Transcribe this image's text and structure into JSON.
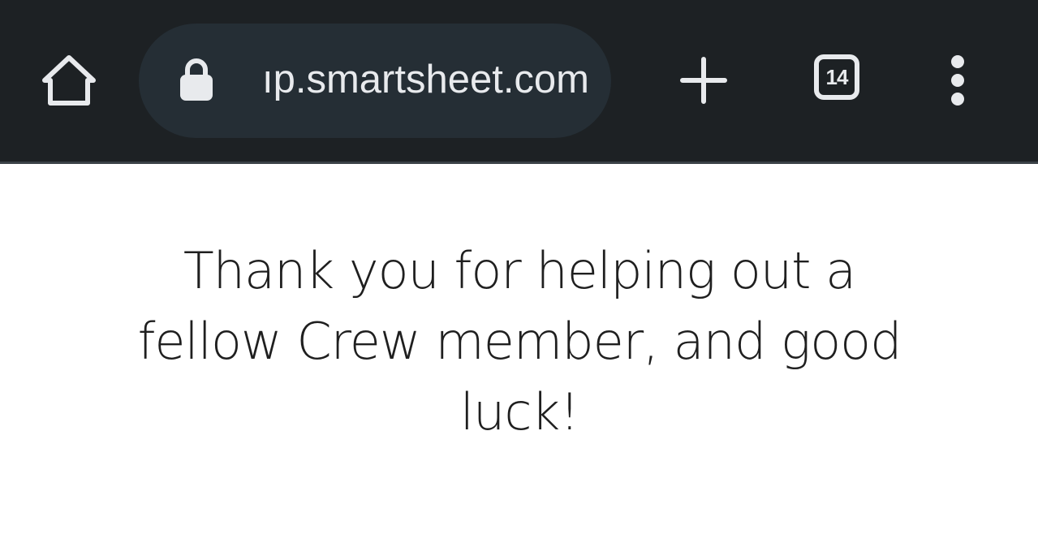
{
  "browser": {
    "toolbar": {
      "home_icon": "home-icon",
      "url_display": "​p.smartsheet.com",
      "url_visible": "ıp.smartsheet.com",
      "lock_icon": "lock-icon",
      "new_tab_icon": "plus-icon",
      "tab_count": "14",
      "menu_icon": "more-vert-icon"
    },
    "colors": {
      "toolbar_bg": "#1d2124",
      "omnibox_bg": "#252e35",
      "icon_color": "#e8eaed",
      "page_bg": "#ffffff",
      "text_color": "#1f1f1f"
    }
  },
  "page": {
    "message": "Thank you for helping out a fellow Crew member, and good luck!"
  }
}
